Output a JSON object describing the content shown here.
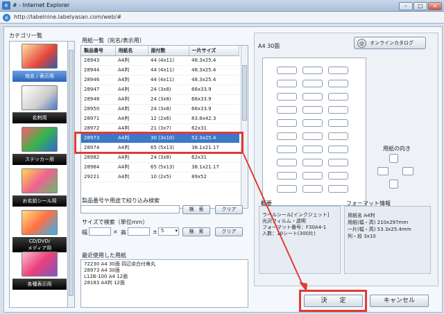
{
  "window": {
    "title": "# - Internet Explorer",
    "url": "http://labelnine.labelyasan.com/web/#"
  },
  "category": {
    "header": "カテゴリ一覧",
    "items": [
      {
        "label": "宛名 / 表示用"
      },
      {
        "label": "名刺用"
      },
      {
        "label": "ステッカー用"
      },
      {
        "label": "お名前シール用"
      },
      {
        "label": "CD/DVD/\nメディア用"
      },
      {
        "label": "各種表示用"
      }
    ]
  },
  "paper_list": {
    "header": "用紙一覧（宛名/表示用）",
    "columns": [
      "製品番号",
      "用紙名",
      "面付数",
      "一片サイズ"
    ],
    "rows": [
      [
        "28943",
        "A4判",
        "44 (4x11)",
        "48.3x25.4"
      ],
      [
        "28944",
        "A4判",
        "44 (4x11)",
        "48.3x25.4"
      ],
      [
        "28946",
        "A4判",
        "44 (4x11)",
        "48.3x25.4"
      ],
      [
        "28947",
        "A4判",
        "24 (3x8)",
        "66x33.9"
      ],
      [
        "28948",
        "A4判",
        "24 (3x8)",
        "66x33.9"
      ],
      [
        "28950",
        "A4判",
        "24 (3x8)",
        "66x33.9"
      ],
      [
        "28971",
        "A4判",
        "12 (2x6)",
        "83.8x42.3"
      ],
      [
        "28972",
        "A4判",
        "21 (3x7)",
        "62x31"
      ],
      [
        "28973",
        "A4判",
        "30 (3x10)",
        "52.3x25.4"
      ],
      [
        "28974",
        "A4判",
        "65 (5x13)",
        "38.1x21.17"
      ],
      [
        "28982",
        "A4判",
        "24 (3x8)",
        "62x31"
      ],
      [
        "28984",
        "A4判",
        "65 (5x13)",
        "38.1x21.17"
      ],
      [
        "29221",
        "A4判",
        "10 (2x5)",
        "89x52"
      ]
    ]
  },
  "filter": {
    "label": "製品番号や用途で絞り込み検索",
    "search_btn": "検　索",
    "clear_btn": "クリア"
  },
  "size_search": {
    "label": "サイズで検索（単位mm）",
    "width_label": "幅",
    "x": "×",
    "height_label": "高",
    "pm": "±",
    "tolerance": "5",
    "search_btn": "検　索",
    "clear_btn": "クリア"
  },
  "recent": {
    "label": "最近使用した用紙",
    "items": [
      "72230 A4 30面 四辺余白付角丸",
      "28973 A4 30面",
      "L12B-100 A4 12面",
      "28183 A4判 12面"
    ]
  },
  "preview": {
    "title": "A4 30面",
    "catalog_btn": "オンラインカタログ",
    "direction_label": "用紙の向き"
  },
  "overview": {
    "title": "概要",
    "lines": [
      "ラベルシール[インクジェット]",
      "光沢フィルム・透明",
      "",
      "フォーマット番号：F30A4-1",
      "",
      "入数：10シート(300片)"
    ]
  },
  "format": {
    "title": "フォーマット情報",
    "lines": [
      "用紙名 A4判",
      "用紙(幅・高) 210x297mm",
      "",
      "一片(幅・高) 53.3x25.4mm",
      "列・段 3x10"
    ]
  },
  "actions": {
    "ok": "決　　定",
    "cancel": "キャンセル"
  },
  "colors": {
    "highlight": "#e23a35",
    "selection": "#3d78c8"
  }
}
